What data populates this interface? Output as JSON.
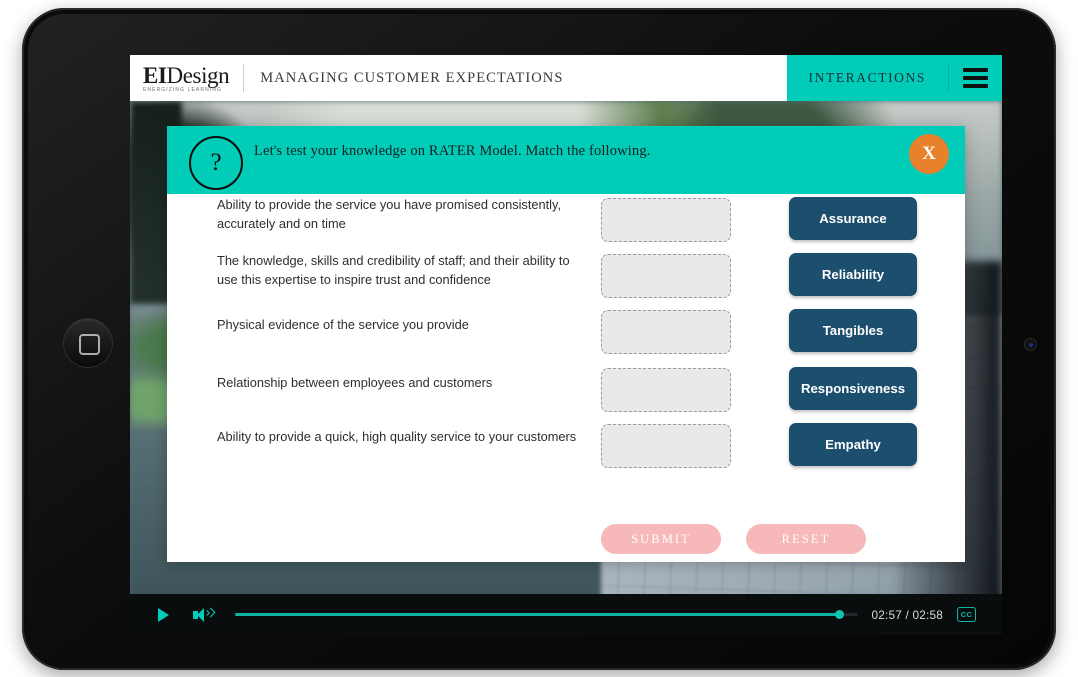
{
  "header": {
    "logo_main_bold": "EI",
    "logo_main_rest": "Design",
    "logo_tagline": "ENERGIZING LEARNING",
    "course_title": "MANAGING CUSTOMER EXPECTATIONS",
    "interactions_label": "INTERACTIONS",
    "menu_icon": "hamburger-menu-icon",
    "accent_color": "#00ccb8"
  },
  "modal": {
    "help_icon": "question-mark-icon",
    "prompt": "Let's test your knowledge on RATER Model. Match the following.",
    "close_label": "X",
    "close_color": "#e8802c",
    "header_color": "#00ccb8",
    "prompts": [
      "Ability to provide the service you have promised consistently, accurately and on time",
      "The knowledge, skills and credibility of staff; and their ability to use this expertise to inspire trust and confidence",
      "Physical evidence of the service you provide",
      "Relationship between employees and customers",
      "Ability to provide a quick, high quality service to your customers"
    ],
    "drop_zones": [
      "",
      "",
      "",
      "",
      ""
    ],
    "drop_zone_placeholder": "",
    "options": [
      "Assurance",
      "Reliability",
      "Tangibles",
      "Responsiveness",
      "Empathy"
    ],
    "option_color": "#1c4e6e",
    "submit_label": "SUBMIT",
    "reset_label": "RESET",
    "action_color": "#f6b8b8"
  },
  "player": {
    "play_icon": "play-icon",
    "volume_icon": "volume-icon",
    "cc_icon": "closed-caption-icon",
    "cc_label": "CC",
    "current_time": "02:57",
    "total_time": "02:58",
    "time_display": "02:57 / 02:58",
    "progress_percent": 97,
    "progress_color": "#0bb3a3"
  },
  "device": {
    "home_button": "home-button-icon",
    "camera": "front-camera-icon"
  }
}
